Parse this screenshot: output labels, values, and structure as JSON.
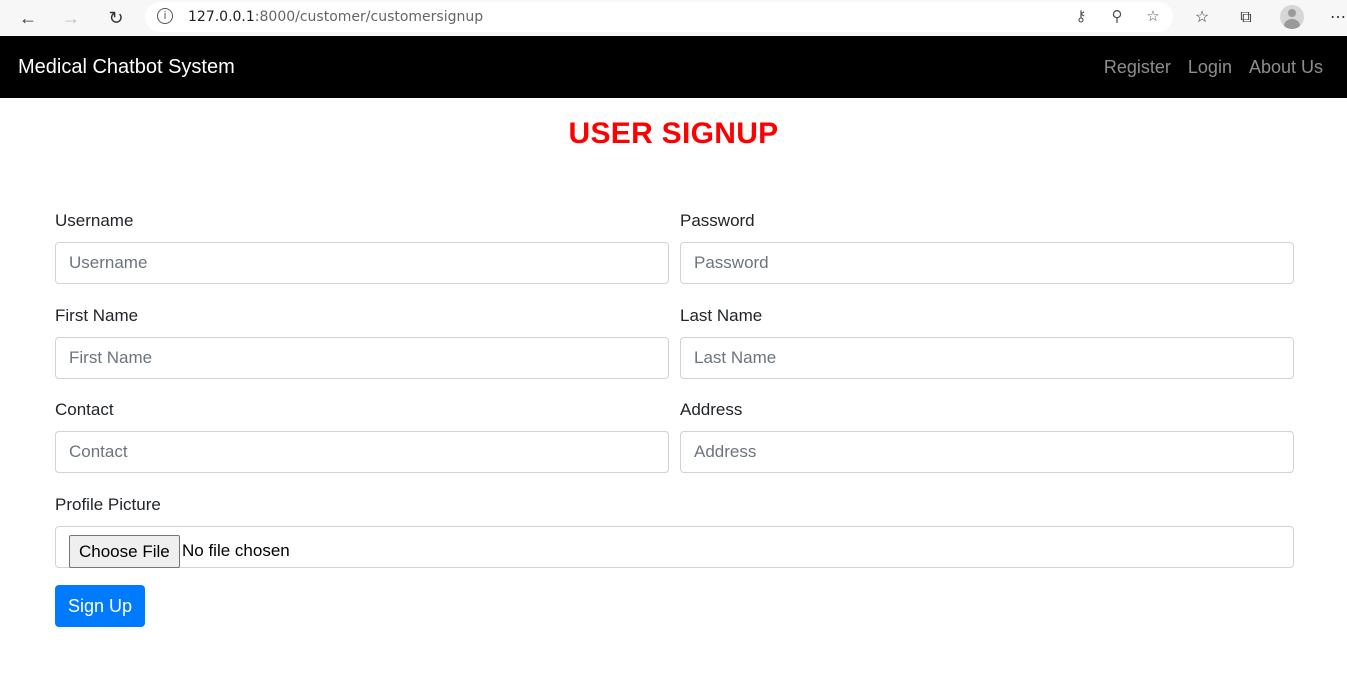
{
  "browser": {
    "url_host": "127.0.0.1",
    "url_path": ":8000/customer/customersignup"
  },
  "navbar": {
    "brand": "Medical Chatbot System",
    "links": [
      "Register",
      "Login",
      "About Us"
    ]
  },
  "page_title": "USER SIGNUP",
  "form": {
    "fields": [
      {
        "label": "Username",
        "placeholder": "Username"
      },
      {
        "label": "Password",
        "placeholder": "Password"
      },
      {
        "label": "First Name",
        "placeholder": "First Name"
      },
      {
        "label": "Last Name",
        "placeholder": "Last Name"
      },
      {
        "label": "Contact",
        "placeholder": "Contact"
      },
      {
        "label": "Address",
        "placeholder": "Address"
      }
    ],
    "profile_picture": {
      "label": "Profile Picture",
      "button_label": "Choose File",
      "status": "No file chosen"
    },
    "submit_label": "Sign Up"
  },
  "colors": {
    "title": "#ff0000",
    "primary": "#007bff",
    "navbar_bg": "#000000"
  }
}
